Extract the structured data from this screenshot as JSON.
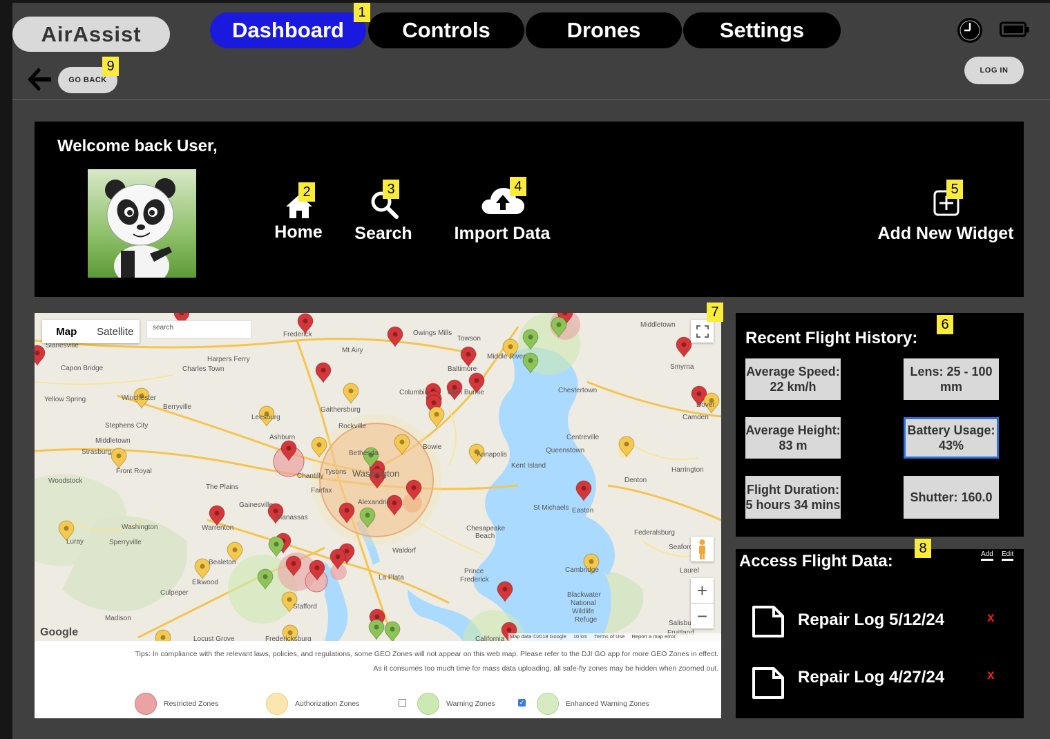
{
  "app": {
    "logo": "AirAssist"
  },
  "nav": {
    "tabs": [
      {
        "label": "Dashboard",
        "active": true
      },
      {
        "label": "Controls",
        "active": false
      },
      {
        "label": "Drones",
        "active": false
      },
      {
        "label": "Settings",
        "active": false
      }
    ]
  },
  "header": {
    "go_back": "GO BACK",
    "log_in": "LOG IN"
  },
  "badges": {
    "b1": "1",
    "b2": "2",
    "b3": "3",
    "b4": "4",
    "b5": "5",
    "b6": "6",
    "b7": "7",
    "b8": "8",
    "b9": "9"
  },
  "welcome": {
    "greeting": "Welcome back User,",
    "actions": {
      "home": "Home",
      "search": "Search",
      "import": "Import Data",
      "add_widget": "Add New Widget"
    }
  },
  "map": {
    "toggle_map": "Map",
    "toggle_satellite": "Satellite",
    "search_placeholder": "search",
    "attribution": "Map data ©2018 Google",
    "scale": "10 km",
    "terms": "Terms of Use",
    "report": "Report a map error",
    "google": "Google",
    "tips_line1": "Tips:  In compliance with the relevant laws, policies, and regulations, some GEO Zones will not appear on this web map. Please refer to the DJI GO app for more GEO Zones in effect.",
    "tips_line2": "As it consumes too much time for mass data uploading, all safe-fly zones may be hidden when zoomed out.",
    "legend": {
      "restricted": "Restricted Zones",
      "authorization": "Authorization Zones",
      "warning": "Warning Zones",
      "enhanced": "Enhanced Warning Zones"
    },
    "legend_colors": {
      "restricted": "#e9a3a3",
      "authorization": "#fbe6b0",
      "warning": "#cde9b3",
      "enhanced": "#d6ebc2"
    },
    "places": [
      "Frederick",
      "Baltimore",
      "Washington",
      "Alexandria",
      "Gaithersburg",
      "Rockville",
      "Columbia",
      "Towson",
      "Bowie",
      "Annapolis",
      "Chestertown",
      "Centreville",
      "Queenstown",
      "Kent Island",
      "St Michaels",
      "Easton",
      "Denton",
      "Harrington",
      "Chesapeake Beach",
      "Waldorf",
      "La Plata",
      "Prince Frederick",
      "Cambridge",
      "Blackwater National Wildlife Refuge",
      "Fairfax",
      "Tysons",
      "Bethesda",
      "Chantilly",
      "Ashburn",
      "Leesburg",
      "Middletown",
      "Smyrna",
      "Dover",
      "Camden",
      "Owings Mills",
      "Glen Burnie",
      "Mt Airy",
      "Harpers Ferry",
      "Charles Town",
      "Capon Bridge",
      "Yellow Spring",
      "Berryville",
      "Winchester",
      "Stephens City",
      "Strasburg",
      "Front Royal",
      "Woodstock",
      "The Plains",
      "Gainesville",
      "Manassas",
      "Warrenton",
      "Sperryville",
      "Luray",
      "Culpeper",
      "Elkwood",
      "Bealeton",
      "Stafford",
      "Fredericksburg",
      "Locust Grove",
      "Madison",
      "Slanesville",
      "Federalsburg",
      "Seaford",
      "Laurel",
      "Salisbury",
      "Fruitland",
      "California",
      "Middle River"
    ]
  },
  "history": {
    "title": "Recent Flight History:",
    "stats": {
      "avg_speed": "Average Speed: 22 km/h",
      "lens": "Lens: 25 - 100 mm",
      "avg_height": "Average Height: 83 m",
      "battery": "Battery Usage: 43%",
      "duration": "Flight Duration: 5 hours 34 mins",
      "shutter": "Shutter: 160.0"
    }
  },
  "access": {
    "title": "Access Flight Data:",
    "add": "Add",
    "edit": "Edit",
    "files": [
      {
        "name": "Repair Log 5/12/24",
        "delete": "x"
      },
      {
        "name": "Repair Log 4/27/24",
        "delete": "x"
      }
    ]
  }
}
